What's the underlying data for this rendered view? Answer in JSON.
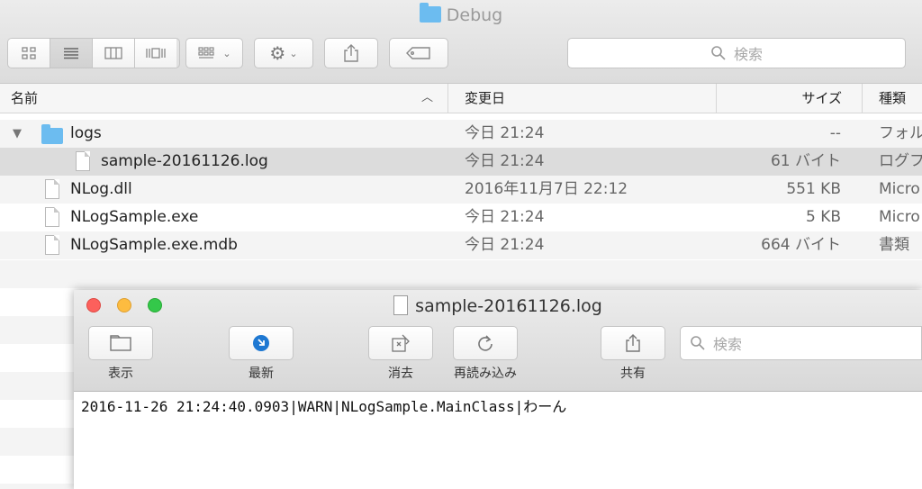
{
  "finder": {
    "title": "Debug",
    "search_placeholder": "検索",
    "columns": {
      "name": "名前",
      "date": "変更日",
      "size": "サイズ",
      "kind": "種類"
    },
    "rows": [
      {
        "name": "logs",
        "date": "今日 21:24",
        "size": "--",
        "kind": "フォル",
        "type": "folder",
        "expanded": true
      },
      {
        "name": "sample-20161126.log",
        "date": "今日 21:24",
        "size": "61 バイト",
        "kind": "ログフ",
        "type": "file",
        "selected": true
      },
      {
        "name": "NLog.dll",
        "date": "2016年11月7日 22:12",
        "size": "551 KB",
        "kind": "Micro",
        "type": "file"
      },
      {
        "name": "NLogSample.exe",
        "date": "今日 21:24",
        "size": "5 KB",
        "kind": "Micro",
        "type": "file"
      },
      {
        "name": "NLogSample.exe.mdb",
        "date": "今日 21:24",
        "size": "664 バイト",
        "kind": "書類",
        "type": "file"
      }
    ]
  },
  "console": {
    "title": "sample-20161126.log",
    "toolbar": {
      "show_label": "表示",
      "latest_label": "最新",
      "clear_label": "消去",
      "reload_label": "再読み込み",
      "share_label": "共有"
    },
    "search_placeholder": "検索",
    "log_line": "2016-11-26 21:24:40.0903|WARN|NLogSample.MainClass|わーん"
  },
  "colors": {
    "close": "#fc605c",
    "minimize": "#fdbc40",
    "zoom": "#34c84a",
    "folder": "#6cbcf0",
    "latest_icon": "#1e78d2",
    "selected_row": "#dcdcdc"
  }
}
